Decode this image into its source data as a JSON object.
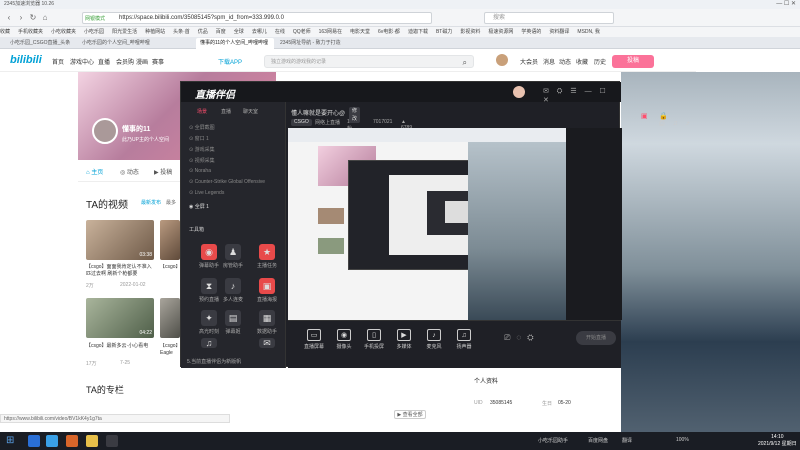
{
  "browser": {
    "title": "2345加速浏览器 10.26",
    "url": "https://space.bilibili.com/35085145?spm_id_from=333.999.0.0",
    "url_tag": "网银模式",
    "search_placeholder": "搜索",
    "bookmarks": [
      "收藏",
      "手机收藏夹",
      "小吃收藏夹",
      "小吃乐园",
      "阳光爱生活",
      "种植网站",
      "头条·首",
      "优品",
      "百度",
      "全球",
      "去哪儿",
      "在线",
      "QQ老师",
      "163网易在",
      "电影天堂",
      "6v电影·都",
      "迪迦下载",
      "BT磁力",
      "影视资料",
      "极速资源网",
      "学英语的",
      "资料翻译",
      "MSDN, 我"
    ],
    "tabs": [
      "小吃乐园_CSGO直播_头条",
      "小吃乐园的个人空间_哔哩哔哩",
      "懂事的11的个人空间_哔哩哔哩",
      "2345网址导航 - 致力于打造"
    ],
    "active_tab": 2
  },
  "bili_header": {
    "logo": "bilibili",
    "nav": [
      "首页",
      "游戏中心",
      "直播",
      "会员购",
      "漫画",
      "赛事"
    ],
    "download": "下载APP",
    "search_placeholder": "独立游戏的游戏我的记录",
    "right_nav": [
      "大会员",
      "消息",
      "动态",
      "收藏",
      "历史",
      "创作中心"
    ],
    "upload": "投稿"
  },
  "profile": {
    "name": "懂事的11",
    "sign": "此乃UP主的个人空间",
    "tabs": [
      "主页",
      "动态",
      "投稿"
    ],
    "videos_title": "TA的视频",
    "videos_tabs": [
      "最新发布",
      "最多"
    ],
    "videos": [
      {
        "title": "【csgo】面面我肯定认不准入匹过去啊 刷新个枪都要",
        "views": "2万",
        "date": "2022-01-02",
        "duration": "03:38"
      },
      {
        "title": "【csgo】",
        "views": "",
        "date": "",
        "duration": ""
      },
      {
        "title": "【csgo】最新多云·小心看电",
        "views": "17万",
        "date": "7-25",
        "duration": "04:22"
      },
      {
        "title": "【csgo】 Eagle",
        "views": "",
        "date": "",
        "duration": ""
      }
    ],
    "column_title": "TA的专栏",
    "status_url": "https://www.bilibili.com/video/BV1kK4y1g7ta"
  },
  "right_panel": {
    "title": "个人资料",
    "uid_label": "UID",
    "uid": "35085145",
    "birthday_label": "生日",
    "birthday": "05-20",
    "view_all": "查看全部"
  },
  "app": {
    "name": "直播伴侣",
    "side_tabs": [
      "场景",
      "直播",
      "聊天室"
    ],
    "scenes": [
      "全屏截图",
      "窗口 1",
      "游戏采集",
      "视频采集",
      "Noraha",
      "Counter-Strike Global Offensive",
      "Live Legends",
      "全屏 1"
    ],
    "tools_label": "工具箱",
    "tools": [
      "弹幕助手",
      "房管助手",
      "主播任务",
      "预约直播",
      "多人连麦",
      "直播海报",
      "高光时刻",
      "弹幕姬",
      "数据助手",
      "音乐点歌",
      "福袋"
    ],
    "notice": "5.当前直播伴侣为新版帆",
    "stream_title": "懂人嘛就是要开心@",
    "edit_label": "修改",
    "category": "CSGO",
    "area": "网络上直播",
    "fans": "1粉丝",
    "room_id": "7017021",
    "popularity": "6789",
    "bottom_tools": [
      "直播屏幕",
      "摄像头",
      "手机投屏",
      "多媒体",
      "麦克风",
      "扬声器"
    ],
    "start_live": "开始直播"
  },
  "taskbar": {
    "time": "14:10",
    "date": "2021/9/12 星期日",
    "tray": [
      "小吃乐园助手",
      "百度网盘",
      "翻译"
    ],
    "volume": "100%"
  }
}
